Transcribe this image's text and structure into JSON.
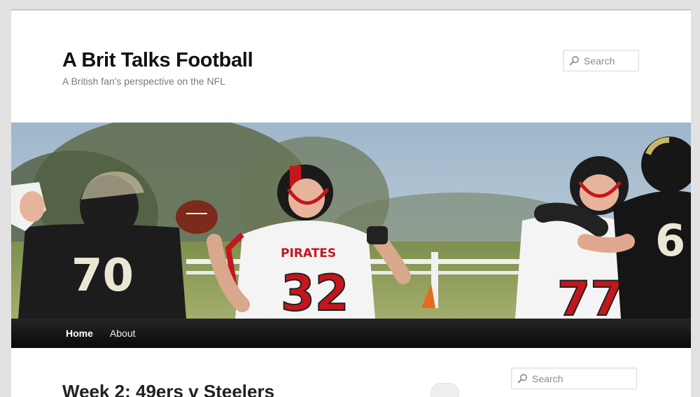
{
  "site": {
    "title": "A Brit Talks Football",
    "description": "A British fan's perspective on the NFL"
  },
  "header_search": {
    "placeholder": "Search",
    "icon": "search-icon"
  },
  "banner": {
    "alt": "American football players in action",
    "jersey_numbers": [
      "70",
      "32",
      "77",
      "6"
    ],
    "team_text": "PIRATES",
    "colors": {
      "sky": "#a9bfd1",
      "grass": "#8fa05f",
      "pirates_red": "#c4161c",
      "dark_jersey": "#1c1c1c"
    }
  },
  "nav": {
    "items": [
      {
        "label": "Home",
        "active": true
      },
      {
        "label": "About",
        "active": false
      }
    ]
  },
  "post": {
    "title": "Week 2: 49ers v Steelers"
  },
  "sidebar_search": {
    "placeholder": "Search",
    "icon": "search-icon"
  }
}
